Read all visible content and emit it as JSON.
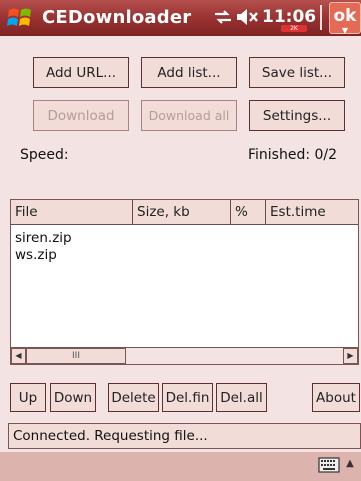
{
  "title_bar": {
    "app_title": "CEDownloader",
    "clock": "11:06",
    "clock_badge": "2K",
    "ok_label": "ok"
  },
  "toolbar_top": {
    "add_url": "Add URL...",
    "add_list": "Add list...",
    "save_list": "Save list..."
  },
  "toolbar_mid": {
    "download": "Download",
    "download_all": "Download all",
    "settings": "Settings..."
  },
  "info": {
    "speed_label": "Speed:",
    "finished": "Finished: 0/2"
  },
  "table": {
    "columns": [
      "File",
      "Size, kb",
      "%",
      "Est.time"
    ],
    "rows": [
      {
        "file": "siren.zip"
      },
      {
        "file": "ws.zip"
      }
    ]
  },
  "scrollbar": {
    "thumb_grip": "III"
  },
  "toolbar_bottom": {
    "up": "Up",
    "down": "Down",
    "delete": "Delete",
    "del_fin": "Del.fin",
    "del_all": "Del.all",
    "about": "About"
  },
  "status": {
    "text": "Connected. Requesting file..."
  },
  "colors": {
    "title_bar": "#97302f",
    "background": "#f3e4e3",
    "button_face": "#f1dcd8",
    "bottom_bar": "#dcb3ad"
  },
  "icons": [
    "windows-logo-icon",
    "connectivity-icon",
    "volume-icon",
    "keyboard-icon",
    "chevron-up-icon"
  ]
}
